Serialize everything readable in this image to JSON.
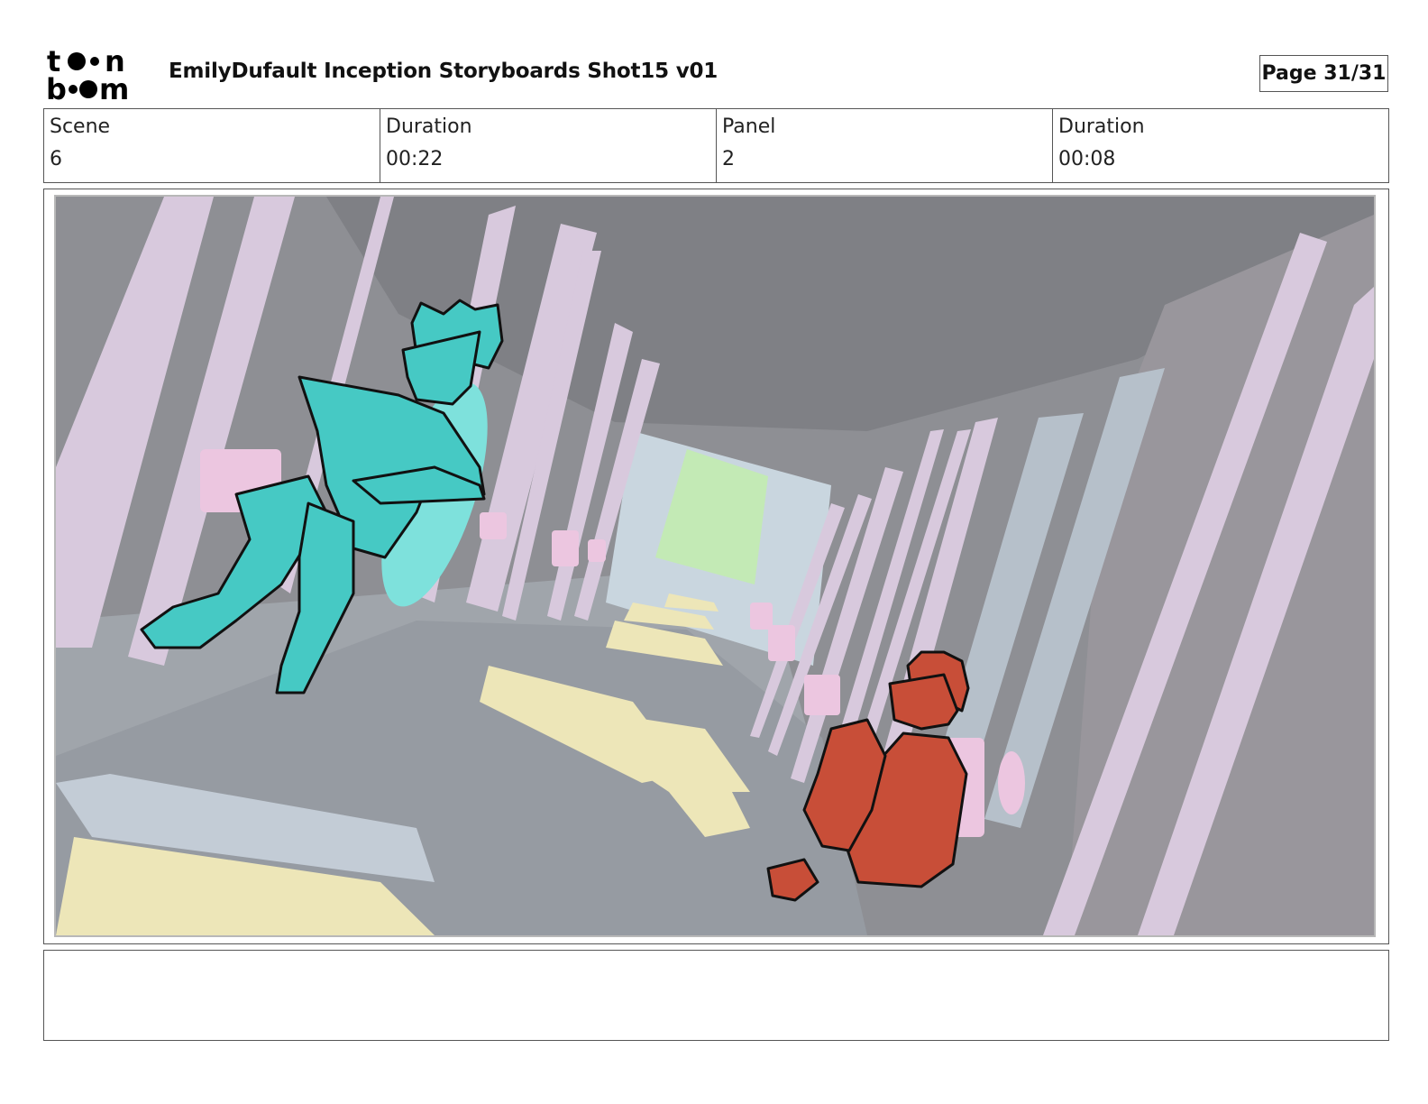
{
  "header": {
    "logo_text": "toon boom",
    "title": "EmilyDufault Inception Storyboards Shot15 v01",
    "page": "Page 31/31"
  },
  "info": {
    "scene_label": "Scene",
    "scene_value": "6",
    "scene_duration_label": "Duration",
    "scene_duration_value": "00:22",
    "panel_label": "Panel",
    "panel_value": "2",
    "panel_duration_label": "Duration",
    "panel_duration_value": "00:08"
  },
  "panel": {
    "characters": [
      "teal-character-floating",
      "red-character-sitting"
    ],
    "colors": {
      "teal_character": "#46c9c4",
      "red_character": "#c84e38",
      "pillar": "#d8c9dd",
      "wall": "#8f9095",
      "corridor_end": "#c3eab5",
      "floor_block": "#ede6b8"
    }
  },
  "notes": {
    "text": ""
  }
}
